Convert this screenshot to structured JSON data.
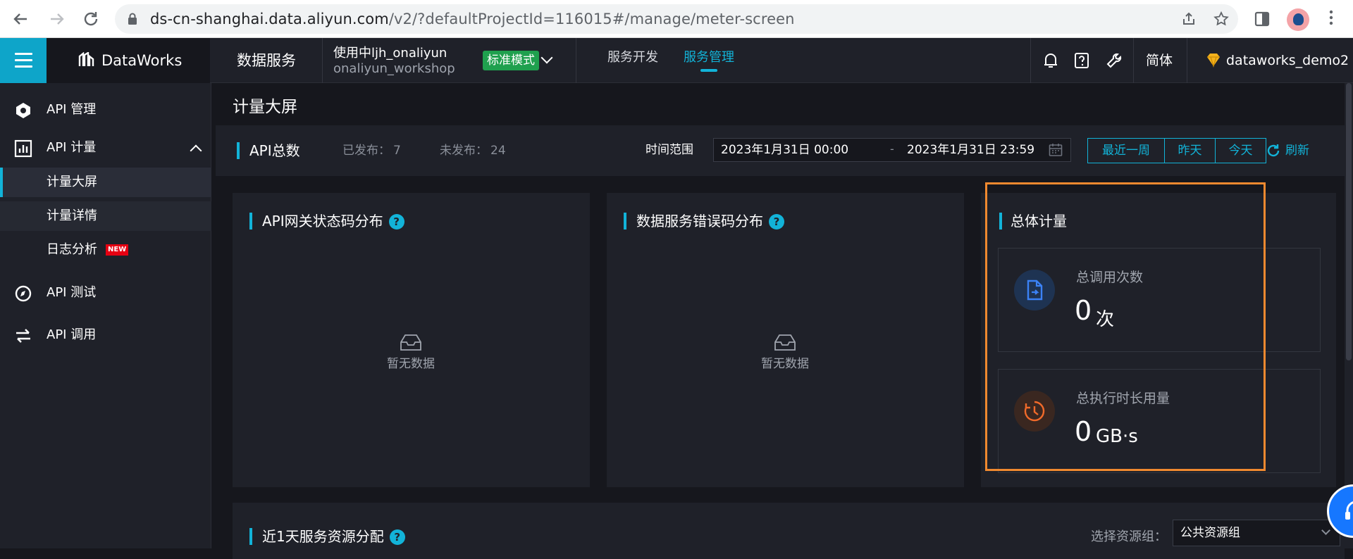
{
  "browser": {
    "url_host": "ds-cn-shanghai.data.aliyun.com",
    "url_path": "/v2/?defaultProjectId=116015#/manage/meter-screen"
  },
  "topbar": {
    "brand": "DataWorks",
    "service": "数据服务",
    "project_line1": "使用中ljh_onaliyun",
    "project_line2": "onaliyun_workshop",
    "mode_badge": "标准模式",
    "nav_tabs": [
      {
        "label": "服务开发",
        "active": false
      },
      {
        "label": "服务管理",
        "active": true
      }
    ],
    "language": "简体",
    "account": "dataworks_demo2"
  },
  "sidebar": {
    "items": [
      {
        "label": "API 管理",
        "icon": "hexagon-icon"
      },
      {
        "label": "API 计量",
        "icon": "bar-chart-icon",
        "expanded": true
      },
      {
        "label": "API 测试",
        "icon": "compass-icon"
      },
      {
        "label": "API 调用",
        "icon": "swap-arrows-icon"
      }
    ],
    "sub_items": [
      {
        "label": "计量大屏",
        "active": true
      },
      {
        "label": "计量详情",
        "active": false
      },
      {
        "label": "日志分析",
        "active": false,
        "badge": "NEW"
      }
    ]
  },
  "main": {
    "page_title": "计量大屏",
    "filter": {
      "title": "API总数",
      "published_label": "已发布：",
      "published_value": "7",
      "unpublished_label": "未发布：",
      "unpublished_value": "24",
      "time_range_label": "时间范围",
      "start": "2023年1月31日 00:00",
      "separator": "-",
      "end": "2023年1月31日 23:59",
      "quick_buttons": [
        "最近一周",
        "昨天",
        "今天"
      ],
      "refresh": "刷新"
    },
    "cards": [
      {
        "title": "API网关状态码分布",
        "empty_text": "暂无数据"
      },
      {
        "title": "数据服务错误码分布",
        "empty_text": "暂无数据"
      }
    ],
    "overall": {
      "title": "总体计量",
      "metrics": [
        {
          "label": "总调用次数",
          "value": "0",
          "unit": "次",
          "icon": "document-icon",
          "color": "#3b82f6"
        },
        {
          "label": "总执行时长用量",
          "value": "0",
          "unit": "GB·s",
          "icon": "timer-icon",
          "color": "#f06a2a"
        }
      ]
    },
    "bottom": {
      "title": "近1天服务资源分配",
      "resource_group_label": "选择资源组：",
      "resource_group_value": "公共资源组"
    }
  },
  "colors": {
    "accent": "#12b3d8",
    "highlight_frame": "#f0892f",
    "mode_badge": "#1fa04e"
  }
}
